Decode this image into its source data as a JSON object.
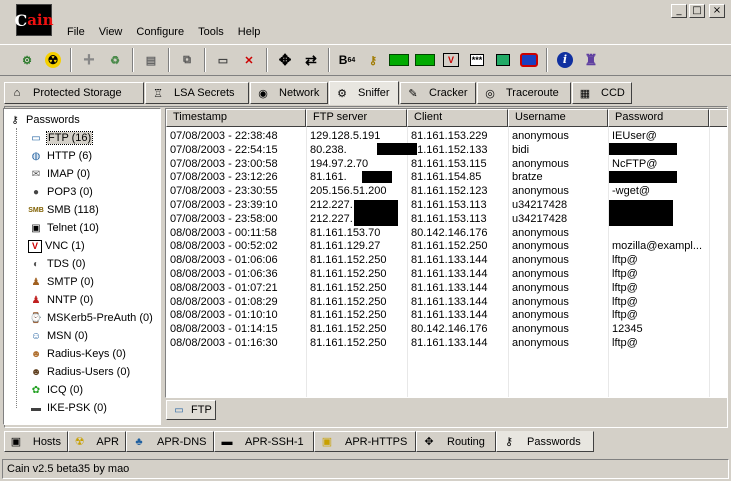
{
  "app": {
    "logo_text": "ain",
    "status": "Cain v2.5 beta35 by mao"
  },
  "window_buttons": [
    "_",
    "□",
    "×"
  ],
  "menu": [
    "File",
    "View",
    "Configure",
    "Tools",
    "Help"
  ],
  "toolbar": {
    "icons": [
      "start-sniffer-icon",
      "start-apr-icon",
      "add-to-list-icon",
      "remove-icon",
      "decode-icon",
      "cisco-icon",
      "network-icon",
      "cross-icon",
      "move-icon",
      "swap-icon",
      "base64-icon",
      "key-icon",
      "meter-icon",
      "meter2-icon",
      "vnc-icon",
      "password-dots-icon",
      "calculator-icon",
      "rdp-icon",
      "info-icon",
      "tool-icon"
    ],
    "base64_label": "B",
    "base64_sub": "64",
    "pwd_label": "***",
    "info_label": "i"
  },
  "top_tabs": [
    {
      "label": "Protected Storage",
      "icon": "⌂"
    },
    {
      "label": "LSA Secrets",
      "icon": "♖"
    },
    {
      "label": "Network",
      "icon": "◉"
    },
    {
      "label": "Sniffer",
      "icon": "⚙",
      "active": true
    },
    {
      "label": "Cracker",
      "icon": "✎"
    },
    {
      "label": "Traceroute",
      "icon": "◎"
    },
    {
      "label": "CCD",
      "icon": "▦"
    }
  ],
  "tree": {
    "root": "Passwords",
    "items": [
      {
        "label": "FTP (16)",
        "icon": "ftp-icon",
        "glyph": "▭",
        "selected": true
      },
      {
        "label": "HTTP (6)",
        "icon": "http-icon",
        "glyph": "◍"
      },
      {
        "label": "IMAP (0)",
        "icon": "imap-icon",
        "glyph": "✉"
      },
      {
        "label": "POP3 (0)",
        "icon": "pop3-icon",
        "glyph": "●"
      },
      {
        "label": "SMB (118)",
        "icon": "smb-icon",
        "glyph": "SMB"
      },
      {
        "label": "Telnet (10)",
        "icon": "telnet-icon",
        "glyph": "▣"
      },
      {
        "label": "VNC (1)",
        "icon": "vnc-icon",
        "glyph": "V"
      },
      {
        "label": "TDS (0)",
        "icon": "tds-icon",
        "glyph": "◐"
      },
      {
        "label": "SMTP (0)",
        "icon": "smtp-icon",
        "glyph": "♟"
      },
      {
        "label": "NNTP (0)",
        "icon": "nntp-icon",
        "glyph": "♟"
      },
      {
        "label": "MSKerb5-PreAuth (0)",
        "icon": "kerberos-icon",
        "glyph": "⌚"
      },
      {
        "label": "MSN (0)",
        "icon": "msn-icon",
        "glyph": "☺"
      },
      {
        "label": "Radius-Keys (0)",
        "icon": "radius-keys-icon",
        "glyph": "☻"
      },
      {
        "label": "Radius-Users (0)",
        "icon": "radius-users-icon",
        "glyph": "☻"
      },
      {
        "label": "ICQ (0)",
        "icon": "icq-icon",
        "glyph": "✿"
      },
      {
        "label": "IKE-PSK (0)",
        "icon": "ike-psk-icon",
        "glyph": "▬"
      }
    ]
  },
  "table": {
    "columns": [
      "Timestamp",
      "FTP server",
      "Client",
      "Username",
      "Password"
    ],
    "rows": [
      [
        "07/08/2003 - 22:38:48",
        "129.128.5.191",
        "81.161.153.229",
        "anonymous",
        "IEUser@"
      ],
      [
        "07/08/2003 - 22:54:15",
        "80.238.",
        "81.161.152.133",
        "bidi",
        ""
      ],
      [
        "07/08/2003 - 23:00:58",
        "194.97.2.70",
        "81.161.153.115",
        "anonymous",
        "NcFTP@"
      ],
      [
        "07/08/2003 - 23:12:26",
        "81.161.",
        "81.161.154.85",
        "bratze",
        ""
      ],
      [
        "07/08/2003 - 23:30:55",
        "205.156.51.200",
        "81.161.152.123",
        "anonymous",
        "-wget@"
      ],
      [
        "07/08/2003 - 23:39:10",
        "212.227.",
        "81.161.153.113",
        "u34217428",
        ""
      ],
      [
        "07/08/2003 - 23:58:00",
        "212.227.",
        "81.161.153.113",
        "u34217428",
        ""
      ],
      [
        "08/08/2003 - 00:11:58",
        "81.161.153.70",
        "80.142.146.176",
        "anonymous",
        ""
      ],
      [
        "08/08/2003 - 00:52:02",
        "81.161.129.27",
        "81.161.152.250",
        "anonymous",
        "mozilla@exampl..."
      ],
      [
        "08/08/2003 - 01:06:06",
        "81.161.152.250",
        "81.161.133.144",
        "anonymous",
        "lftp@"
      ],
      [
        "08/08/2003 - 01:06:36",
        "81.161.152.250",
        "81.161.133.144",
        "anonymous",
        "lftp@"
      ],
      [
        "08/08/2003 - 01:07:21",
        "81.161.152.250",
        "81.161.133.144",
        "anonymous",
        "lftp@"
      ],
      [
        "08/08/2003 - 01:08:29",
        "81.161.152.250",
        "81.161.133.144",
        "anonymous",
        "lftp@"
      ],
      [
        "08/08/2003 - 01:10:10",
        "81.161.152.250",
        "81.161.133.144",
        "anonymous",
        "lftp@"
      ],
      [
        "08/08/2003 - 01:14:15",
        "81.161.152.250",
        "80.142.146.176",
        "anonymous",
        "12345"
      ],
      [
        "08/08/2003 - 01:16:30",
        "81.161.152.250",
        "81.161.133.144",
        "anonymous",
        "lftp@"
      ]
    ]
  },
  "sub_tab": {
    "label": "FTP"
  },
  "bottom_tabs": [
    {
      "label": "Hosts",
      "icon": "▣"
    },
    {
      "label": "APR",
      "icon": "☢"
    },
    {
      "label": "APR-DNS",
      "icon": "♣"
    },
    {
      "label": "APR-SSH-1",
      "icon": "▬"
    },
    {
      "label": "APR-HTTPS",
      "icon": "🔒"
    },
    {
      "label": "Routing",
      "icon": "✥"
    },
    {
      "label": "Passwords",
      "icon": "⚷",
      "active": true
    }
  ]
}
